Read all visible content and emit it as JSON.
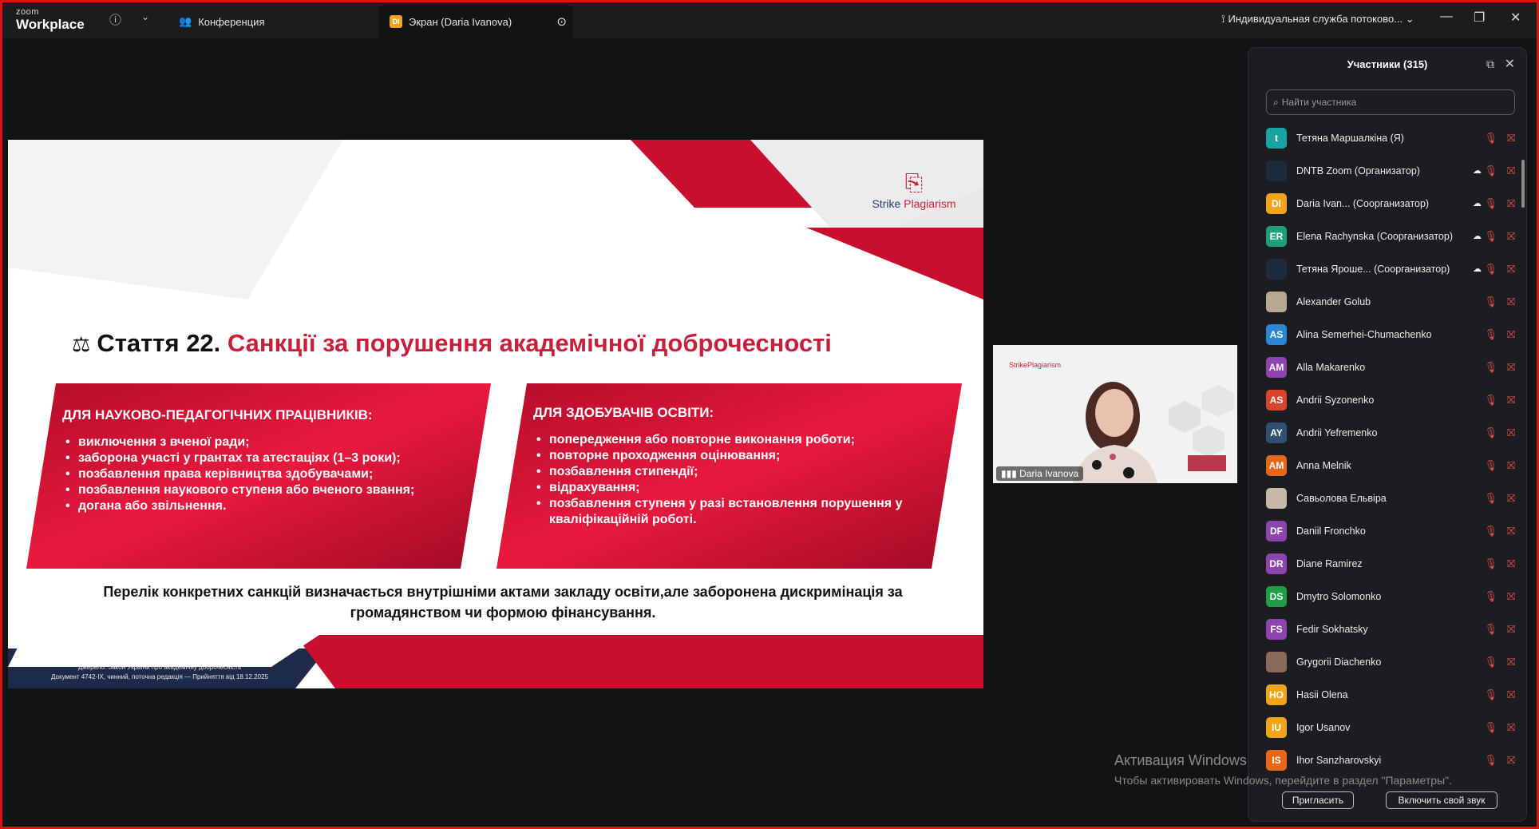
{
  "titlebar": {
    "logo_small": "zoom",
    "logo_big": "Workplace",
    "tab_conference": "Конференция",
    "tab_screen": "Экран (Daria Ivanova)",
    "tab_screen_badge": "DI",
    "streaming": "Индивидуальная служба потоково..."
  },
  "slide": {
    "logo_text_a": "Strike ",
    "logo_text_b": "Plagiarism",
    "title_black": "Стаття 22. ",
    "title_red": "Санкції за порушення академічної доброчесності",
    "left_box": {
      "heading": "ДЛЯ НАУКОВО-ПЕДАГОГІЧНИХ ПРАЦІВНИКІВ:",
      "items": [
        "виключення з вченої ради;",
        "заборона участі у грантах та атестаціях (1–3 роки);",
        "позбавлення права керівництва здобувачами;",
        "позбавлення наукового ступеня або вченого звання;",
        "догана або звільнення."
      ]
    },
    "right_box": {
      "heading": "ДЛЯ ЗДОБУВАЧІВ ОСВІТИ:",
      "items": [
        "попередження або повторне виконання роботи;",
        "повторне проходження оцінювання;",
        "позбавлення стипендії;",
        "відрахування;",
        "позбавлення ступеня у разі встановлення порушення у кваліфікаційній роботі."
      ]
    },
    "footer_line1": "Перелік конкретних санкцій визначається внутрішніми актами закладу освіти,але заборонена дискримінація за",
    "footer_line2": "громадянством чи формою фінансування.",
    "source_line1": "Джерело: Закон України про академічну доброчесність",
    "source_line2": "Документ 4742-IX, чинний, поточна редакція — Прийняття від 18.12.2025"
  },
  "video": {
    "name": "Daria Ivanova",
    "slide_logo": "StrikePlagiarism"
  },
  "panel": {
    "title": "Участники (315)",
    "search_placeholder": "Найти участника",
    "participants": [
      {
        "initials": "t",
        "name": "Тетяна Маршалкіна (Я)",
        "color": "#1aa3a3",
        "cloud": false
      },
      {
        "initials": "",
        "name": "DNTB Zoom (Организатор)",
        "color": "#1d2a3c",
        "cloud": true
      },
      {
        "initials": "DI",
        "name": "Daria Ivan...  (Соорганизатор)",
        "color": "#f0a419",
        "cloud": true
      },
      {
        "initials": "ER",
        "name": "Elena Rachynska (Соорганизатор)",
        "color": "#1f9e7a",
        "cloud": true
      },
      {
        "initials": "",
        "name": "Тетяна Ярoше...  (Соорганизатор)",
        "color": "#1d2a3c",
        "cloud": true
      },
      {
        "initials": "",
        "name": "Alexander Golub",
        "color": "#b8a890",
        "cloud": false
      },
      {
        "initials": "AS",
        "name": "Alina Semerhei-Chumachenko",
        "color": "#2b87d1",
        "cloud": false
      },
      {
        "initials": "AM",
        "name": "Alla Makarenko",
        "color": "#8e44ad",
        "cloud": false
      },
      {
        "initials": "AS",
        "name": "Andrii Syzonenko",
        "color": "#d9442f",
        "cloud": false
      },
      {
        "initials": "AY",
        "name": "Andrii Yefremenko",
        "color": "#2f4f73",
        "cloud": false
      },
      {
        "initials": "AM",
        "name": "Anna Melnik",
        "color": "#e8661a",
        "cloud": false
      },
      {
        "initials": "",
        "name": "Савьолова Ельвіра",
        "color": "#c8b8a8",
        "cloud": false
      },
      {
        "initials": "DF",
        "name": "Daniil Fronchko",
        "color": "#8e44ad",
        "cloud": false
      },
      {
        "initials": "DR",
        "name": "Diane Ramirez",
        "color": "#8e44ad",
        "cloud": false
      },
      {
        "initials": "DS",
        "name": "Dmytro Solomonko",
        "color": "#1f9e4a",
        "cloud": false
      },
      {
        "initials": "FS",
        "name": "Fedir Sokhatsky",
        "color": "#8e44ad",
        "cloud": false
      },
      {
        "initials": "",
        "name": "Grygorii Diachenko",
        "color": "#8a6a5a",
        "cloud": false
      },
      {
        "initials": "HO",
        "name": "Hasii Olena",
        "color": "#f0a419",
        "cloud": false
      },
      {
        "initials": "IU",
        "name": "Igor Usanov",
        "color": "#f0a419",
        "cloud": false
      },
      {
        "initials": "IS",
        "name": "Ihor Sanzharovskyi",
        "color": "#e8661a",
        "cloud": false
      }
    ],
    "invite_label": "Пригласить",
    "unmute_label": "Включить свой звук"
  },
  "watermark": {
    "line1": "Активация Windows",
    "line2": "Чтобы активировать Windows, перейдите в раздел \"Параметры\"."
  }
}
